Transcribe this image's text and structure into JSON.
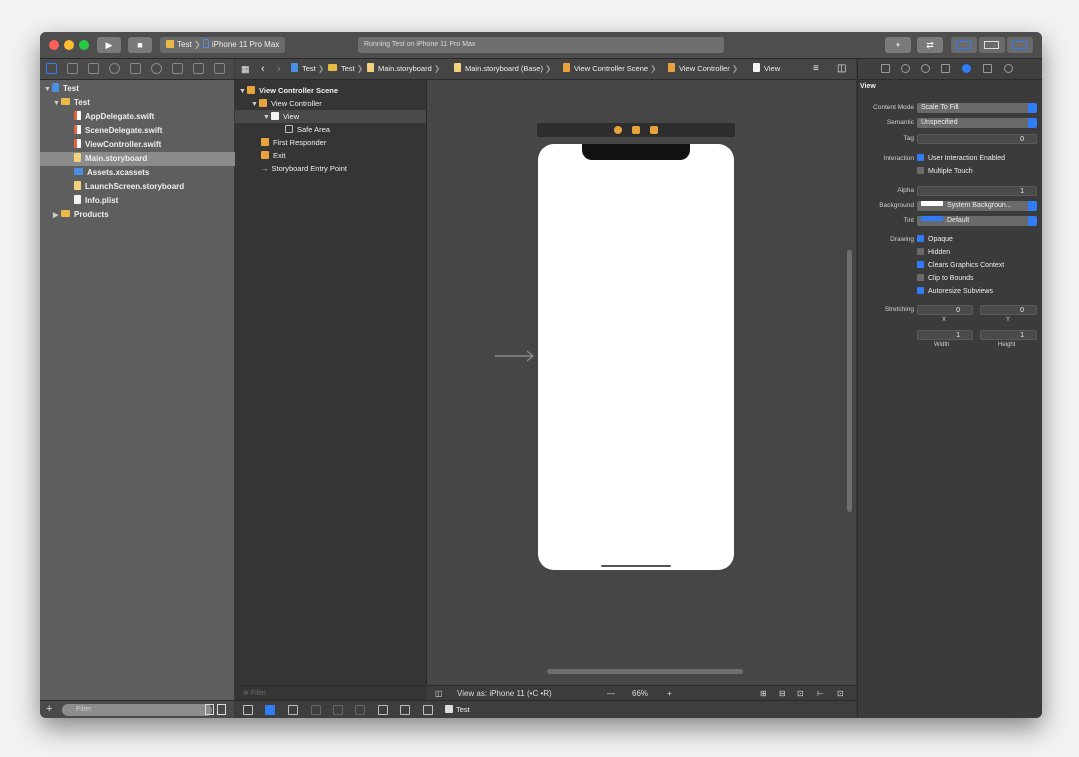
{
  "toolbar": {
    "scheme_target": "Test",
    "scheme_device": "iPhone 11 Pro Max",
    "activity_status": "Running Test on iPhone 11 Pro Max"
  },
  "navigator": {
    "items": [
      {
        "label": "Test",
        "icon": "project-icon"
      },
      {
        "label": "Test",
        "icon": "folder-icon"
      },
      {
        "label": "AppDelegate.swift",
        "icon": "swift-file-icon"
      },
      {
        "label": "SceneDelegate.swift",
        "icon": "swift-file-icon"
      },
      {
        "label": "ViewController.swift",
        "icon": "swift-file-icon"
      },
      {
        "label": "Main.storyboard",
        "icon": "storyboard-file-icon",
        "selected": true
      },
      {
        "label": "Assets.xcassets",
        "icon": "asset-catalog-icon"
      },
      {
        "label": "LaunchScreen.storyboard",
        "icon": "storyboard-file-icon"
      },
      {
        "label": "Info.plist",
        "icon": "plist-file-icon"
      },
      {
        "label": "Products",
        "icon": "folder-icon"
      }
    ],
    "filter_placeholder": "Filter"
  },
  "jumpbar": {
    "crumbs": [
      "Test",
      "Test",
      "Main.storyboard",
      "Main.storyboard (Base)",
      "View Controller Scene",
      "View Controller",
      "View"
    ]
  },
  "outline": {
    "items": [
      {
        "label": "View Controller Scene"
      },
      {
        "label": "View Controller"
      },
      {
        "label": "View",
        "selected": true
      },
      {
        "label": "Safe Area"
      },
      {
        "label": "First Responder"
      },
      {
        "label": "Exit"
      },
      {
        "label": "Storyboard Entry Point"
      }
    ],
    "filter_placeholder": "Filter"
  },
  "canvas": {
    "view_as": "View as: iPhone 11 (•C •R)",
    "zoom_minus": "—",
    "zoom": "66%",
    "zoom_plus": "+"
  },
  "debugbar": {
    "target": "Test"
  },
  "inspector": {
    "section": "View",
    "content_mode_label": "Content Mode",
    "content_mode": "Scale To Fill",
    "semantic_label": "Semantic",
    "semantic": "Unspecified",
    "tag_label": "Tag",
    "tag": "0",
    "interaction_label": "Interaction",
    "user_interaction": "User Interaction Enabled",
    "multiple_touch": "Multiple Touch",
    "alpha_label": "Alpha",
    "alpha": "1",
    "background_label": "Background",
    "background": "System Backgroun...",
    "tint_label": "Tint",
    "tint": "Default",
    "drawing_label": "Drawing",
    "opaque": "Opaque",
    "hidden": "Hidden",
    "clears_graphics": "Clears Graphics Context",
    "clip_to_bounds": "Clip to Bounds",
    "autoresize": "Autoresize Subviews",
    "stretching_label": "Stretching",
    "stretch_x": "0",
    "stretch_y": "0",
    "x_label": "X",
    "y_label": "Y",
    "stretch_w": "1",
    "stretch_h": "1",
    "width_label": "Width",
    "height_label": "Height"
  },
  "colors": {
    "accent": "#2f7cf6",
    "close": "#fe5f57",
    "minimize": "#febc2e",
    "zoom": "#28c840",
    "folder": "#e9b948"
  }
}
